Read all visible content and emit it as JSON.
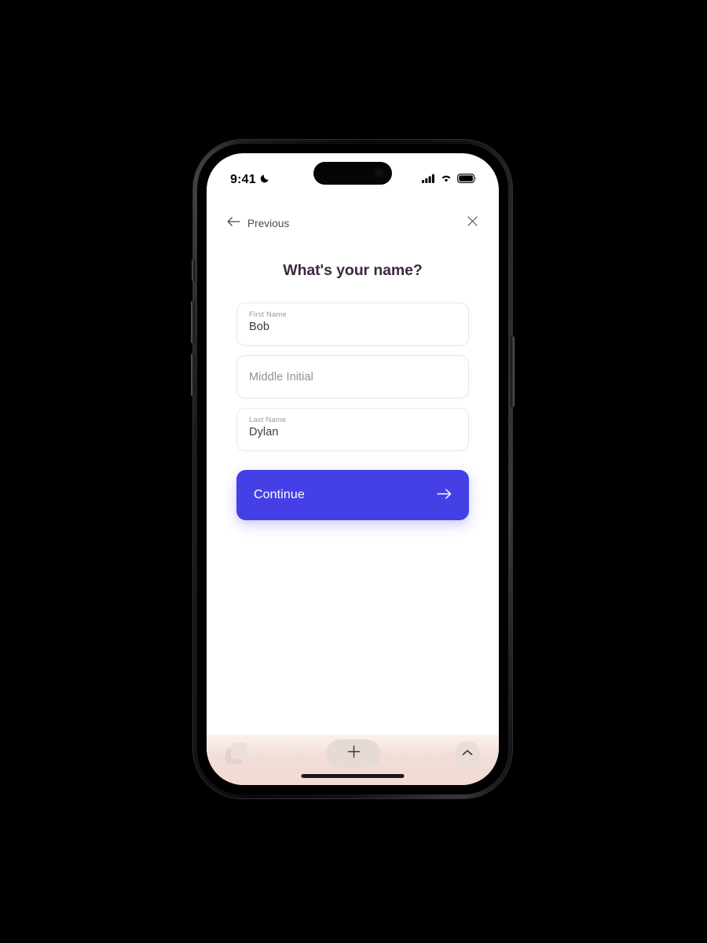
{
  "status_bar": {
    "time": "9:41",
    "dnd_icon": "crescent-moon-icon",
    "cellular_icon": "cellular-bars-icon",
    "wifi_icon": "wifi-icon",
    "battery_icon": "battery-full-icon"
  },
  "nav": {
    "back_label": "Previous",
    "back_icon": "arrow-left-icon",
    "close_icon": "close-x-icon"
  },
  "page_title": "What's your name?",
  "form": {
    "fields": [
      {
        "name": "first-name",
        "label": "First Name",
        "value": "Bob",
        "placeholder": "First Name",
        "filled": true
      },
      {
        "name": "middle-initial",
        "label": "Middle Initial",
        "value": "",
        "placeholder": "Middle Initial",
        "filled": false
      },
      {
        "name": "last-name",
        "label": "Last Name",
        "value": "Dylan",
        "placeholder": "Last Name",
        "filled": true
      }
    ],
    "submit_label": "Continue",
    "submit_icon": "arrow-right-icon"
  },
  "bottom_bar": {
    "tabs_icon": "tabs-stack-icon",
    "add_icon": "plus-icon",
    "expand_icon": "chevron-up-icon"
  },
  "colors": {
    "accent": "#4540e5",
    "title": "#3d2840",
    "field_border": "#e8e8ec",
    "bottom_bar": "#f3d9d3"
  }
}
